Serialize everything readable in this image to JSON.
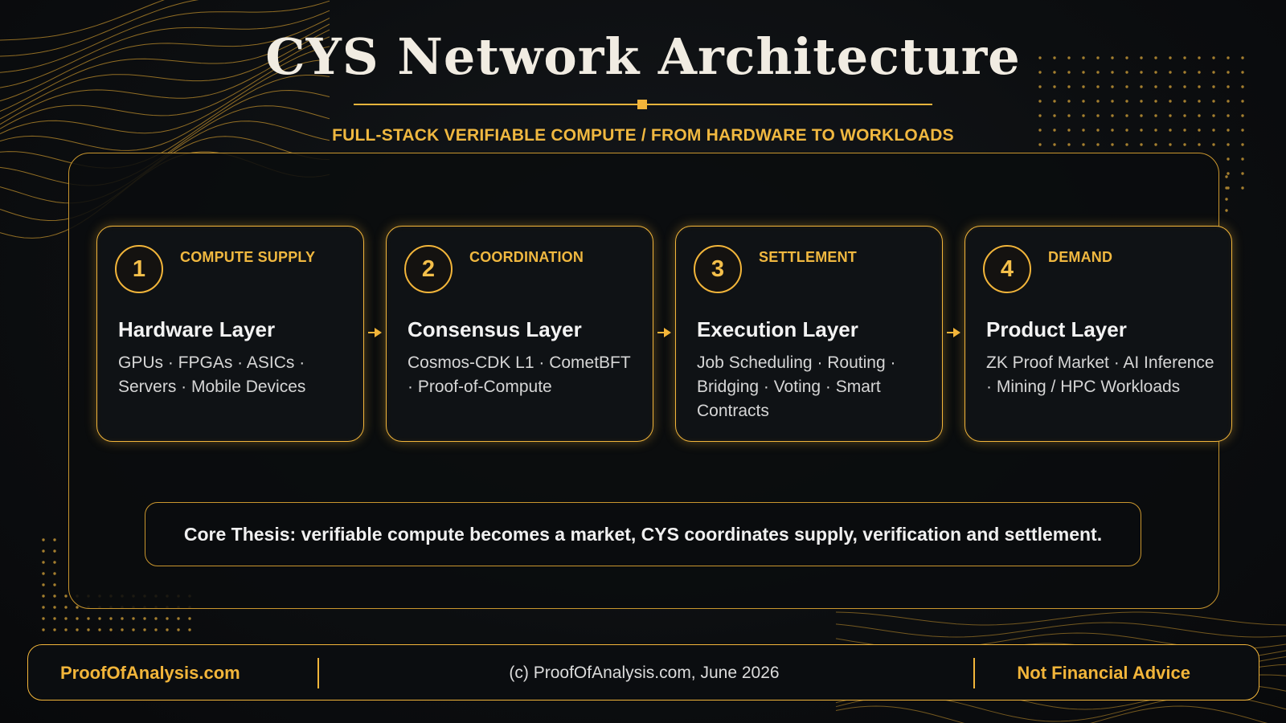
{
  "header": {
    "title": "CYS Network Architecture",
    "subtitle": "FULL-STACK VERIFIABLE COMPUTE / FROM HARDWARE TO WORKLOADS"
  },
  "layers": [
    {
      "number": "1",
      "kicker": "COMPUTE SUPPLY",
      "title": "Hardware Layer",
      "body": "GPUs · FPGAs · ASICs · Servers · Mobile Devices"
    },
    {
      "number": "2",
      "kicker": "COORDINATION",
      "title": "Consensus Layer",
      "body": "Cosmos-CDK L1 · CometBFT · Proof-of-Compute"
    },
    {
      "number": "3",
      "kicker": "SETTLEMENT",
      "title": "Execution Layer",
      "body": "Job Scheduling · Routing · Bridging · Voting · Smart Contracts"
    },
    {
      "number": "4",
      "kicker": "DEMAND",
      "title": "Product Layer",
      "body": "ZK Proof Market · AI Inference · Mining / HPC Workloads"
    }
  ],
  "thesis": "Core Thesis: verifiable compute becomes a market, CYS coordinates supply, verification and settlement.",
  "footer": {
    "left": "ProofOfAnalysis.com",
    "center": "(c) ProofOfAnalysis.com, June 2026",
    "right": "Not Financial Advice"
  },
  "colors": {
    "accent": "#f2b53a",
    "background": "#0c0e10",
    "card": "#0f1215",
    "text": "#f1ece2"
  },
  "icons": [
    "arrow-right-icon"
  ]
}
